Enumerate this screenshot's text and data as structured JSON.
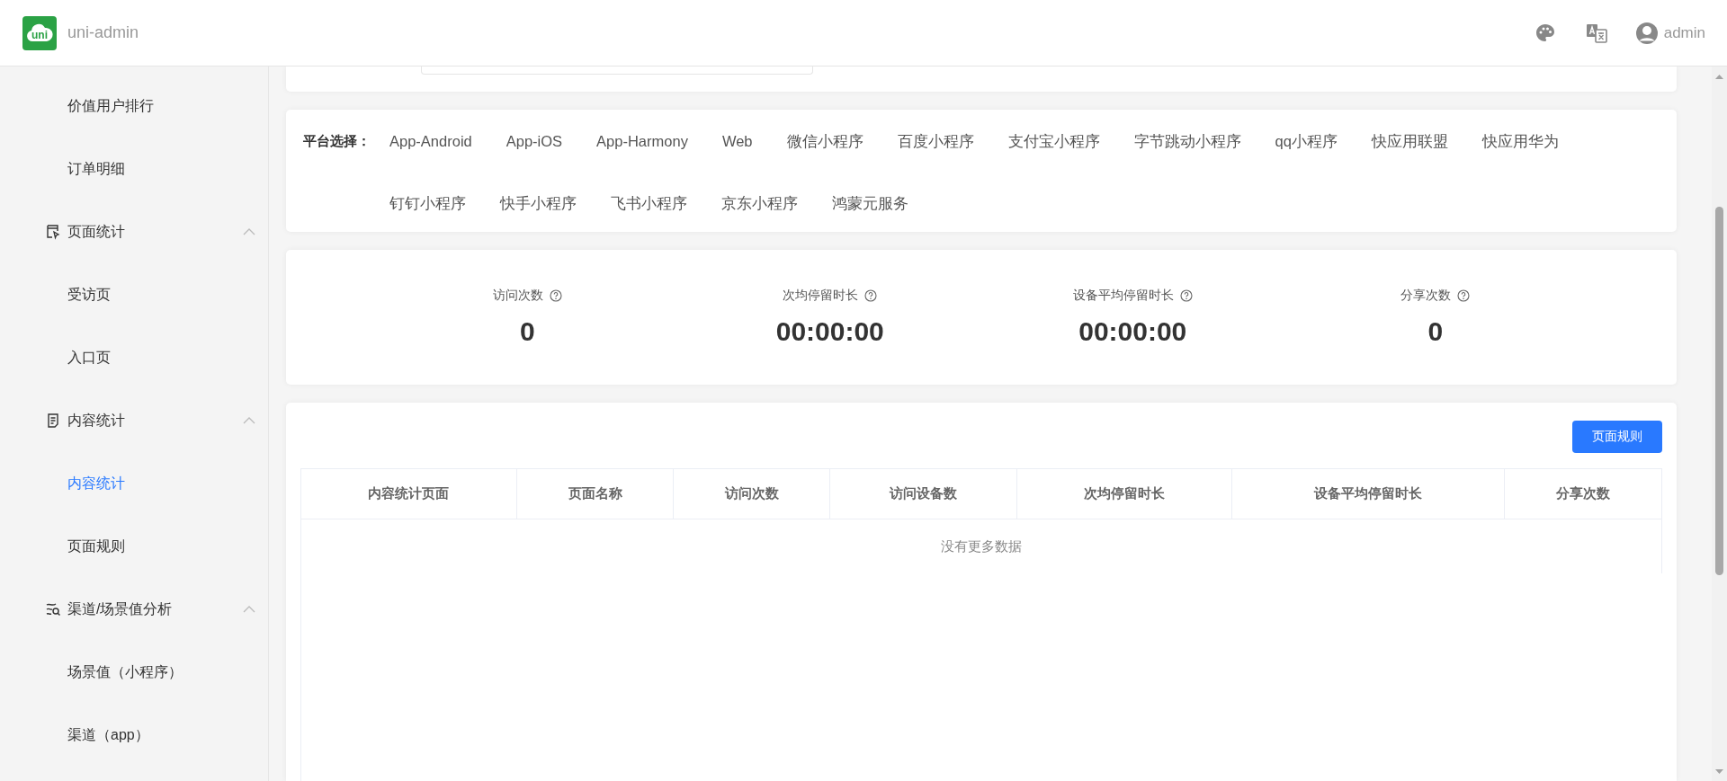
{
  "header": {
    "logo_text": "uni",
    "title": "uni-admin",
    "user": "admin"
  },
  "sidebar": {
    "items": [
      {
        "kind": "sub",
        "label": "价值用户排行",
        "selected": false
      },
      {
        "kind": "sub",
        "label": "订单明细",
        "selected": false
      },
      {
        "kind": "group",
        "label": "页面统计",
        "expanded": true
      },
      {
        "kind": "sub",
        "label": "受访页",
        "selected": false
      },
      {
        "kind": "sub",
        "label": "入口页",
        "selected": false
      },
      {
        "kind": "group",
        "label": "内容统计",
        "expanded": true
      },
      {
        "kind": "sub",
        "label": "内容统计",
        "selected": true
      },
      {
        "kind": "sub",
        "label": "页面规则",
        "selected": false
      },
      {
        "kind": "group",
        "label": "渠道/场景值分析",
        "expanded": true
      },
      {
        "kind": "sub",
        "label": "场景值（小程序）",
        "selected": false
      },
      {
        "kind": "sub",
        "label": "渠道（app）",
        "selected": false
      }
    ]
  },
  "platform": {
    "label": "平台选择：",
    "options": [
      "App-Android",
      "App-iOS",
      "App-Harmony",
      "Web",
      "微信小程序",
      "百度小程序",
      "支付宝小程序",
      "字节跳动小程序",
      "qq小程序",
      "快应用联盟",
      "快应用华为",
      "钉钉小程序",
      "快手小程序",
      "飞书小程序",
      "京东小程序",
      "鸿蒙元服务"
    ]
  },
  "stats": [
    {
      "label": "访问次数",
      "value": "0"
    },
    {
      "label": "次均停留时长",
      "value": "00:00:00"
    },
    {
      "label": "设备平均停留时长",
      "value": "00:00:00"
    },
    {
      "label": "分享次数",
      "value": "0"
    }
  ],
  "table": {
    "button": "页面规则",
    "columns": [
      "内容统计页面",
      "页面名称",
      "访问次数",
      "访问设备数",
      "次均停留时长",
      "设备平均停留时长",
      "分享次数"
    ],
    "empty_text": "没有更多数据"
  }
}
